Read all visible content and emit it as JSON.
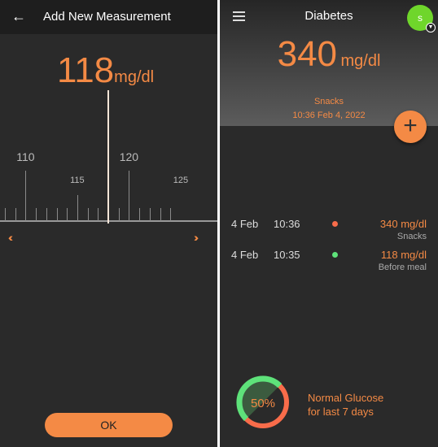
{
  "left": {
    "title": "Add New Measurement",
    "value": "118",
    "unit": "mg/dl",
    "ruler": {
      "min": 104,
      "max": 124,
      "selected": 118,
      "major_labels": [
        "110",
        "120"
      ],
      "minor_labels": [
        "115",
        "125"
      ]
    },
    "ok_label": "OK"
  },
  "right": {
    "title": "Diabetes",
    "avatar_letter": "s",
    "latest": {
      "value": "340",
      "unit": "mg/dl",
      "tag": "Snacks",
      "datetime": "10:36 Feb 4, 2022"
    },
    "entries": [
      {
        "date": "4 Feb",
        "time": "10:36",
        "status_color": "#f86c4a",
        "value": "340 mg/dl",
        "tag": "Snacks"
      },
      {
        "date": "4 Feb",
        "time": "10:35",
        "status_color": "#5ee27a",
        "value": "118 mg/dl",
        "tag": "Before meal"
      }
    ],
    "summary": {
      "percent": "50%",
      "percent_value": 50,
      "line1": "Normal Glucose",
      "line2": "for last 7 days"
    }
  },
  "colors": {
    "accent": "#f48a45",
    "normal": "#5ee27a",
    "high": "#f86c4a",
    "avatar": "#6fd62b"
  }
}
